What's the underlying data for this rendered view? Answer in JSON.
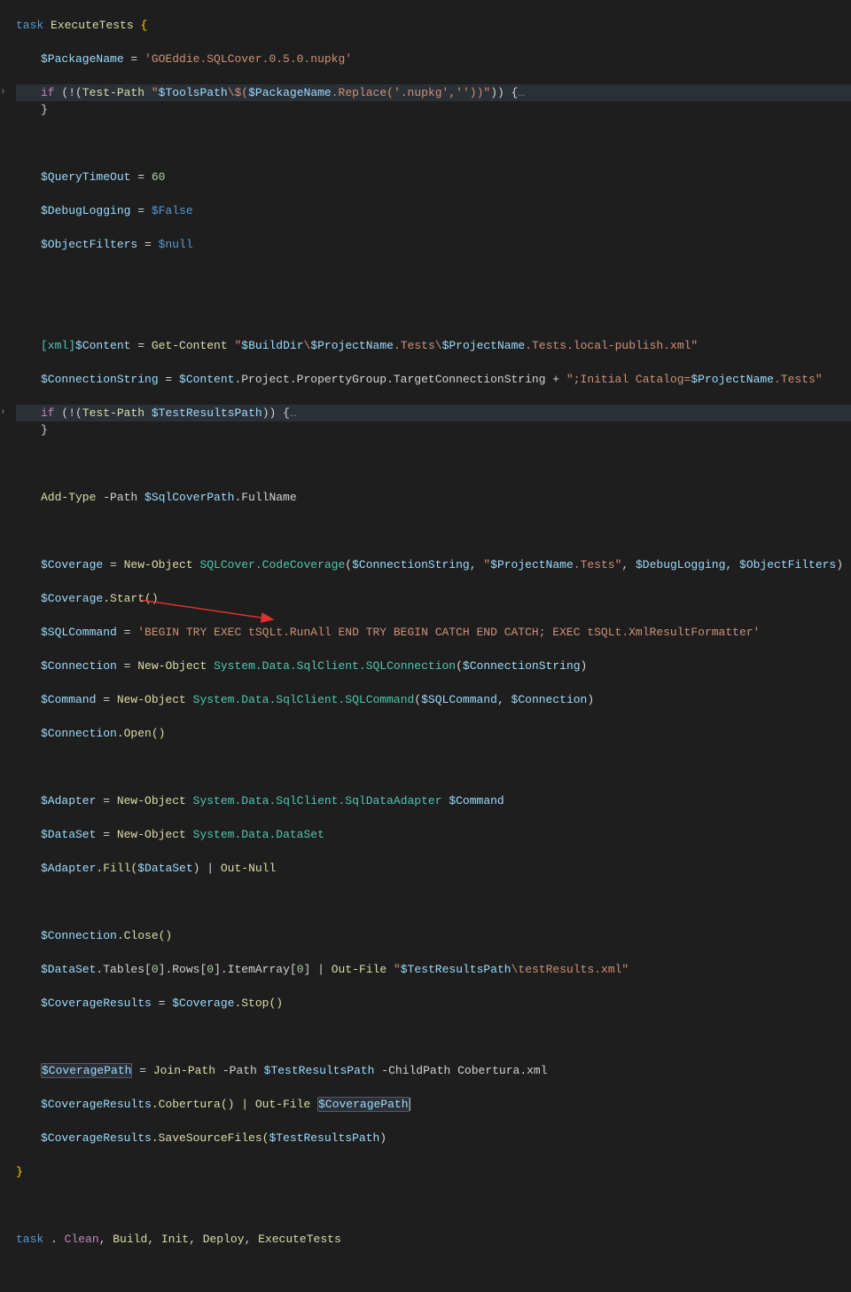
{
  "code": {
    "l1_task": "task",
    "l1_name": "ExecuteTests",
    "l1_brace": "{",
    "l2_var": "$PackageName",
    "l2_eq": " = ",
    "l2_str": "'GOEddie.SQLCover.0.5.0.nupkg'",
    "l3_if": "if",
    "l3_open": " (!(",
    "l3_test": "Test-Path",
    "l3_sp": " ",
    "l3_str1": "\"",
    "l3_var1": "$ToolsPath",
    "l3_str2": "\\",
    "l3_dol": "$(",
    "l3_var2": "$PackageName",
    "l3_dot": ".Replace(",
    "l3_arg1": "'.nupkg'",
    "l3_comma": ",",
    "l3_arg2": "''",
    "l3_close1": "))",
    "l3_str3": "\"",
    "l3_close2": ")) {",
    "l3_ellipsis": "…",
    "l4_brace": "}",
    "l6_var": "$QueryTimeOut",
    "l6_eq": " = ",
    "l6_val": "60",
    "l7_var": "$DebugLogging",
    "l7_eq": " = ",
    "l7_val": "$False",
    "l8_var": "$ObjectFilters",
    "l8_eq": " = ",
    "l8_val": "$null",
    "l11_type": "[xml]",
    "l11_var": "$Content",
    "l11_eq": " = ",
    "l11_cmd": "Get-Content",
    "l11_sp": " ",
    "l11_str1": "\"",
    "l11_v1": "$BuildDir",
    "l11_s1": "\\",
    "l11_v2": "$ProjectName",
    "l11_s2": ".Tests\\",
    "l11_v3": "$ProjectName",
    "l11_s3": ".Tests.local-publish.xml\"",
    "l12_var": "$ConnectionString",
    "l12_eq": " = ",
    "l12_v1": "$Content",
    "l12_chain": ".Project.PropertyGroup.TargetConnectionString + ",
    "l12_str1": "\";Initial Catalog=",
    "l12_v2": "$ProjectName",
    "l12_str2": ".Tests\"",
    "l13_if": "if",
    "l13_open": " (!(",
    "l13_test": "Test-Path",
    "l13_sp": " ",
    "l13_var": "$TestResultsPath",
    "l13_close": ")) {",
    "l13_ellipsis": "…",
    "l14_brace": "}",
    "l16_cmd": "Add-Type",
    "l16_param": " -Path ",
    "l16_var": "$SqlCoverPath",
    "l16_mem": ".FullName",
    "l18_var": "$Coverage",
    "l18_eq": " = ",
    "l18_cmd": "New-Object",
    "l18_sp": " ",
    "l18_type": "SQLCover.CodeCoverage",
    "l18_open": "(",
    "l18_a1": "$ConnectionString",
    "l18_c1": ", ",
    "l18_str1": "\"",
    "l18_a2": "$ProjectName",
    "l18_str2": ".Tests\"",
    "l18_c2": ", ",
    "l18_a3": "$DebugLogging",
    "l18_c3": ", ",
    "l18_a4": "$ObjectFilters",
    "l18_close": ")",
    "l19_var": "$Coverage",
    "l19_call": ".Start()",
    "l20_var": "$SQLCommand",
    "l20_eq": " = ",
    "l20_str": "'BEGIN TRY EXEC tSQLt.RunAll END TRY BEGIN CATCH END CATCH; EXEC tSQLt.XmlResultFormatter'",
    "l21_var": "$Connection",
    "l21_eq": " = ",
    "l21_cmd": "New-Object",
    "l21_sp": " ",
    "l21_type": "System.Data.SqlClient.SQLConnection",
    "l21_open": "(",
    "l21_arg": "$ConnectionString",
    "l21_close": ")",
    "l22_var": "$Command",
    "l22_eq": " = ",
    "l22_cmd": "New-Object",
    "l22_sp": " ",
    "l22_type": "System.Data.SqlClient.SQLCommand",
    "l22_open": "(",
    "l22_a1": "$SQLCommand",
    "l22_c": ", ",
    "l22_a2": "$Connection",
    "l22_close": ")",
    "l23_var": "$Connection",
    "l23_call": ".Open()",
    "l25_var": "$Adapter",
    "l25_eq": " = ",
    "l25_cmd": "New-Object",
    "l25_sp": " ",
    "l25_type": "System.Data.SqlClient.SqlDataAdapter",
    "l25_sp2": " ",
    "l25_arg": "$Command",
    "l26_var": "$DataSet",
    "l26_eq": " = ",
    "l26_cmd": "New-Object",
    "l26_sp": " ",
    "l26_type": "System.Data.DataSet",
    "l27_var": "$Adapter",
    "l27_call": ".Fill(",
    "l27_arg": "$DataSet",
    "l27_close": ") | ",
    "l27_cmd": "Out-Null",
    "l29_var": "$Connection",
    "l29_call": ".Close()",
    "l30_var": "$DataSet",
    "l30_chain": ".Tables[",
    "l30_n1": "0",
    "l30_chain2": "].Rows[",
    "l30_n2": "0",
    "l30_chain3": "].ItemArray[",
    "l30_n3": "0",
    "l30_chain4": "] | ",
    "l30_cmd": "Out-File",
    "l30_sp": " ",
    "l30_str1": "\"",
    "l30_v1": "$TestResultsPath",
    "l30_str2": "\\testResults.xml\"",
    "l31_var": "$CoverageResults",
    "l31_eq": " = ",
    "l31_v": "$Coverage",
    "l31_call": ".Stop()",
    "l33_var": "$CoveragePath",
    "l33_eq": " = ",
    "l33_cmd": "Join-Path",
    "l33_p1": " -Path ",
    "l33_a1": "$TestResultsPath",
    "l33_p2": " -ChildPath ",
    "l33_a2": "Cobertura.xml",
    "l34_var": "$CoverageResults",
    "l34_call": ".Cobertura() | ",
    "l34_cmd": "Out-File",
    "l34_sp": " ",
    "l34_arg": "$CoveragePath",
    "l35_var": "$CoverageResults",
    "l35_call": ".SaveSourceFiles(",
    "l35_arg": "$TestResultsPath",
    "l35_close": ")",
    "l36_brace": "}",
    "l38_task": "task",
    "l38_dot": " . ",
    "l38_t1": "Clean",
    "l38_c1": ", ",
    "l38_t2": "Build",
    "l38_c2": ", ",
    "l38_t3": "Init",
    "l38_c3": ", ",
    "l38_t4": "Deploy",
    "l38_c4": ", ",
    "l38_t5": "ExecuteTests"
  }
}
